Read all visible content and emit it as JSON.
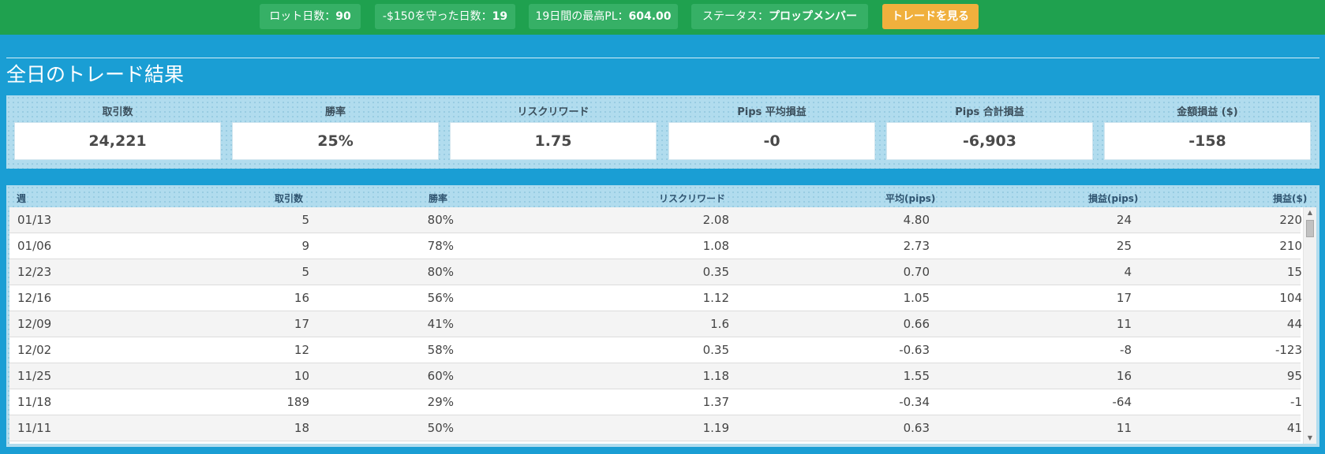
{
  "topbar": {
    "lot_days_label": "ロット日数：",
    "lot_days_value": "90",
    "guard_label": "-$150を守った日数：",
    "guard_value": "19",
    "best_pl_label": "19日間の最高PL：",
    "best_pl_value": "604.00",
    "status_label": "ステータス：",
    "status_value": "プロップメンバー",
    "view_trades_label": "トレードを見る",
    "bar_color": "#1fa14f",
    "button_color": "#f0b03d"
  },
  "page": {
    "title": "全日のトレード結果",
    "background": "#1a9ed4"
  },
  "stats": [
    {
      "label": "取引数",
      "value": "24,221"
    },
    {
      "label": "勝率",
      "value": "25%"
    },
    {
      "label": "リスクリワード",
      "value": "1.75"
    },
    {
      "label": "Pips 平均損益",
      "value": "-0"
    },
    {
      "label": "Pips 合計損益",
      "value": "-6,903"
    },
    {
      "label": "金額損益 ($)",
      "value": "-158"
    }
  ],
  "table": {
    "headers": [
      "週",
      "取引数",
      "勝率",
      "リスクリワード",
      "平均(pips)",
      "損益(pips)",
      "損益($)"
    ],
    "rows": [
      [
        "01/13",
        "5",
        "80%",
        "2.08",
        "4.80",
        "24",
        "220"
      ],
      [
        "01/06",
        "9",
        "78%",
        "1.08",
        "2.73",
        "25",
        "210"
      ],
      [
        "12/23",
        "5",
        "80%",
        "0.35",
        "0.70",
        "4",
        "15"
      ],
      [
        "12/16",
        "16",
        "56%",
        "1.12",
        "1.05",
        "17",
        "104"
      ],
      [
        "12/09",
        "17",
        "41%",
        "1.6",
        "0.66",
        "11",
        "44"
      ],
      [
        "12/02",
        "12",
        "58%",
        "0.35",
        "-0.63",
        "-8",
        "-123"
      ],
      [
        "11/25",
        "10",
        "60%",
        "1.18",
        "1.55",
        "16",
        "95"
      ],
      [
        "11/18",
        "189",
        "29%",
        "1.37",
        "-0.34",
        "-64",
        "-1"
      ],
      [
        "11/11",
        "18",
        "50%",
        "1.19",
        "0.63",
        "11",
        "41"
      ]
    ]
  },
  "icons": {
    "scroll_up": "scroll-up-arrow-icon",
    "scroll_down": "scroll-down-arrow-icon"
  }
}
